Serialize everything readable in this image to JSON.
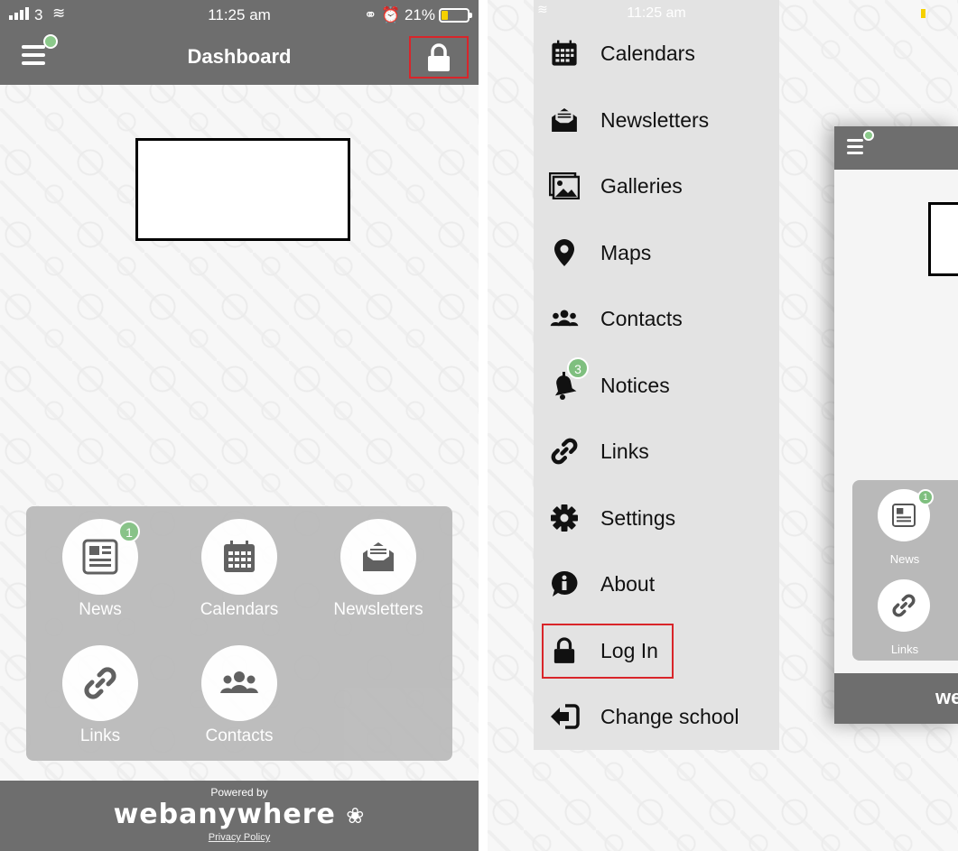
{
  "status_bar": {
    "carrier": "3",
    "time": "11:25 am",
    "battery_text": "21%",
    "battery_level": 0.21,
    "accent_yellow": "#f5d000"
  },
  "header": {
    "title": "Dashboard",
    "menu_icon": "hamburger-icon",
    "lock_icon": "lock-icon",
    "bar_color": "#6e6e6e"
  },
  "dashboard_tiles": [
    {
      "label": "News",
      "icon": "newspaper-icon",
      "badge": "1"
    },
    {
      "label": "Calendars",
      "icon": "calendar-icon",
      "badge": ""
    },
    {
      "label": "Newsletters",
      "icon": "envelope-icon",
      "badge": ""
    },
    {
      "label": "Links",
      "icon": "link-icon",
      "badge": ""
    },
    {
      "label": "Contacts",
      "icon": "people-icon",
      "badge": ""
    }
  ],
  "footer": {
    "powered_by": "Powered by",
    "brand": "webanywhere",
    "privacy": "Privacy Policy"
  },
  "menu": {
    "time": "11:25 am",
    "items": [
      {
        "label": "Calendars",
        "icon": "calendar-icon"
      },
      {
        "label": "Newsletters",
        "icon": "envelope-icon"
      },
      {
        "label": "Galleries",
        "icon": "gallery-icon"
      },
      {
        "label": "Maps",
        "icon": "map-pin-icon"
      },
      {
        "label": "Contacts",
        "icon": "people-icon"
      },
      {
        "label": "Notices",
        "icon": "bell-icon",
        "badge": "3"
      },
      {
        "label": "Links",
        "icon": "link-icon"
      },
      {
        "label": "Settings",
        "icon": "gear-icon"
      },
      {
        "label": "About",
        "icon": "info-icon"
      },
      {
        "label": "Log In",
        "icon": "lock-icon"
      },
      {
        "label": "Change school",
        "icon": "sign-out-icon"
      }
    ]
  },
  "preview": {
    "tiles": [
      {
        "label": "News",
        "badge": "1"
      },
      {
        "label": "Links"
      }
    ],
    "footer_fragment": "we"
  },
  "highlight_color": "#d9252a",
  "badge_color": "#7fbf7f"
}
